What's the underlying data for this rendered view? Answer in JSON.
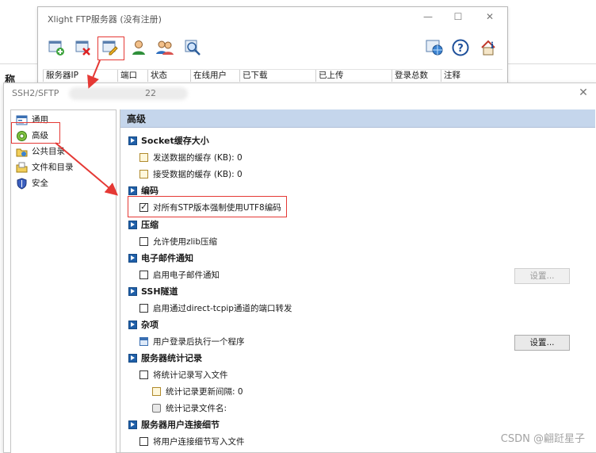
{
  "background": {
    "left_label": "称"
  },
  "main_window": {
    "title": "Xlight FTP服务器 (没有注册)",
    "controls": {
      "minimize": "—",
      "maximize": "☐",
      "close": "✕"
    },
    "columns": [
      "服务器IP",
      "端口",
      "状态",
      "在线用户",
      "已下载",
      "已上传",
      "登录总数",
      "注释"
    ],
    "toolbar_icons": [
      "add-server-icon",
      "delete-server-icon",
      "edit-server-icon",
      "user-icon",
      "group-icon",
      "search-icon",
      "network-icon",
      "help-icon",
      "info-icon"
    ]
  },
  "dialog": {
    "title": "SSH2/SFTP",
    "port": "22",
    "close": "✕",
    "nav": [
      {
        "label": "通用",
        "icon": "window-icon"
      },
      {
        "label": "高级",
        "icon": "gear-icon"
      },
      {
        "label": "公共目录",
        "icon": "folder-share-icon"
      },
      {
        "label": "文件和目录",
        "icon": "folder-icon"
      },
      {
        "label": "安全",
        "icon": "shield-icon"
      }
    ],
    "content_title": "高级",
    "sections": {
      "socket": {
        "title": "Socket缓存大小",
        "send": "发送数据的缓存 (KB): 0",
        "recv": "接受数据的缓存 (KB): 0"
      },
      "encoding": {
        "title": "编码",
        "utf8": "对所有STP版本强制使用UTF8编码",
        "utf8_checked": true
      },
      "compress": {
        "title": "压缩",
        "zlib": "允许使用zlib压缩",
        "zlib_checked": false
      },
      "email": {
        "title": "电子邮件通知",
        "enable": "启用电子邮件通知",
        "enable_checked": false,
        "button": "设置..."
      },
      "ssh_tunnel": {
        "title": "SSH隧道",
        "forward": "启用通过direct-tcpip通道的端口转发",
        "forward_checked": false
      },
      "misc": {
        "title": "杂项",
        "run_program": "用户登录后执行一个程序",
        "button": "设置..."
      },
      "stats": {
        "title": "服务器统计记录",
        "write": "将统计记录写入文件",
        "write_checked": false,
        "interval": "统计记录更新间隔: 0",
        "filename": "统计记录文件名:"
      },
      "conn_detail": {
        "title": "服务器用户连接细节",
        "write": "将用户连接细节写入文件",
        "write_checked": false
      }
    }
  },
  "watermark": "CSDN @翩跹星子",
  "colors": {
    "header_bg": "#c5d6ec",
    "annotation_red": "#e53935",
    "section_icon": "#1f5fa8"
  }
}
